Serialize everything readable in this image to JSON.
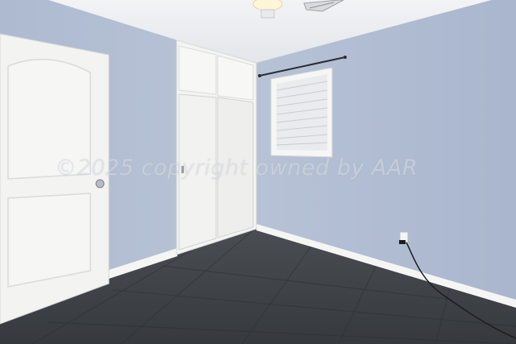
{
  "photo": {
    "watermark_text": "©2025 copyright owned by AAR"
  },
  "colors": {
    "wall_left": "#b4c0d4",
    "wall_right": "#b0bdd3",
    "ceiling": "#eceff3",
    "floor": "#3f4347",
    "trim": "#f7f7f5",
    "door": "#f3f3f1"
  }
}
